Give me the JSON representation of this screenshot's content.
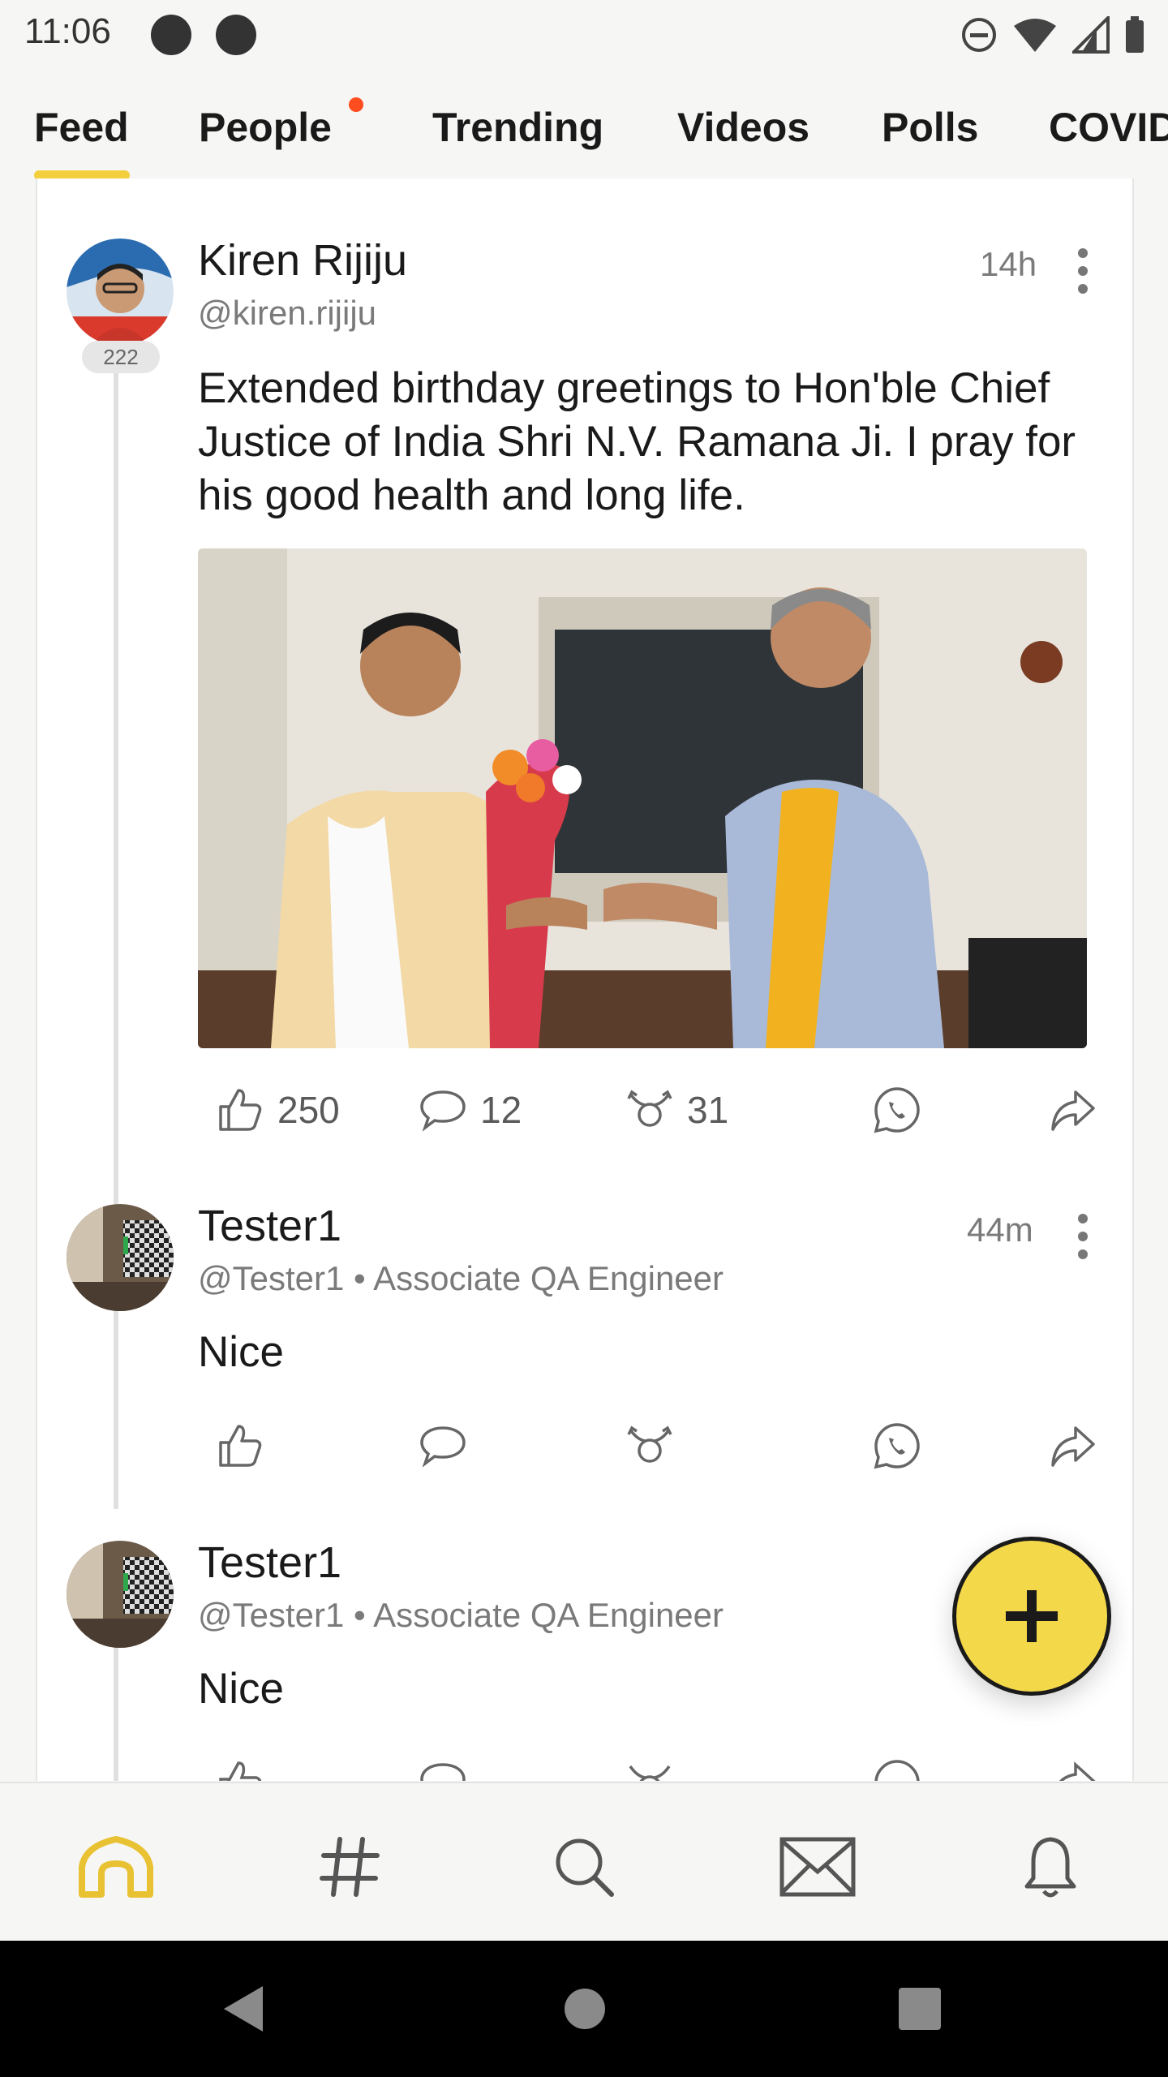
{
  "status_bar": {
    "time": "11:06"
  },
  "tabs": [
    {
      "label": "Feed"
    },
    {
      "label": "People"
    },
    {
      "label": "Trending"
    },
    {
      "label": "Videos"
    },
    {
      "label": "Polls"
    },
    {
      "label": "COVID"
    }
  ],
  "posts": [
    {
      "author": "Kiren Rijiju",
      "handle": "@kiren.rijiju",
      "time": "14h",
      "badge": "222",
      "text": "Extended birthday greetings to Hon'ble Chief Justice of India Shri N.V. Ramana Ji. I pray for his good health and long life.",
      "likes": "250",
      "comments": "12",
      "shares": "31"
    },
    {
      "author": "Tester1",
      "handle": "@Tester1 • Associate QA Engineer",
      "time": "44m",
      "text": "Nice"
    },
    {
      "author": "Tester1",
      "handle": "@Tester1 • Associate QA Engineer",
      "text": "Nice"
    }
  ],
  "colors": {
    "accent": "#f3cf3d",
    "fab": "#f3d84a",
    "notification_dot": "#ff4d1f",
    "home_icon": "#e9c234"
  },
  "icons": {
    "bottom_nav": [
      "home-icon",
      "hashtag-icon",
      "search-icon",
      "mail-icon",
      "bell-icon"
    ],
    "actions": [
      "like-icon",
      "comment-icon",
      "repost-icon",
      "whatsapp-icon",
      "share-icon"
    ]
  }
}
